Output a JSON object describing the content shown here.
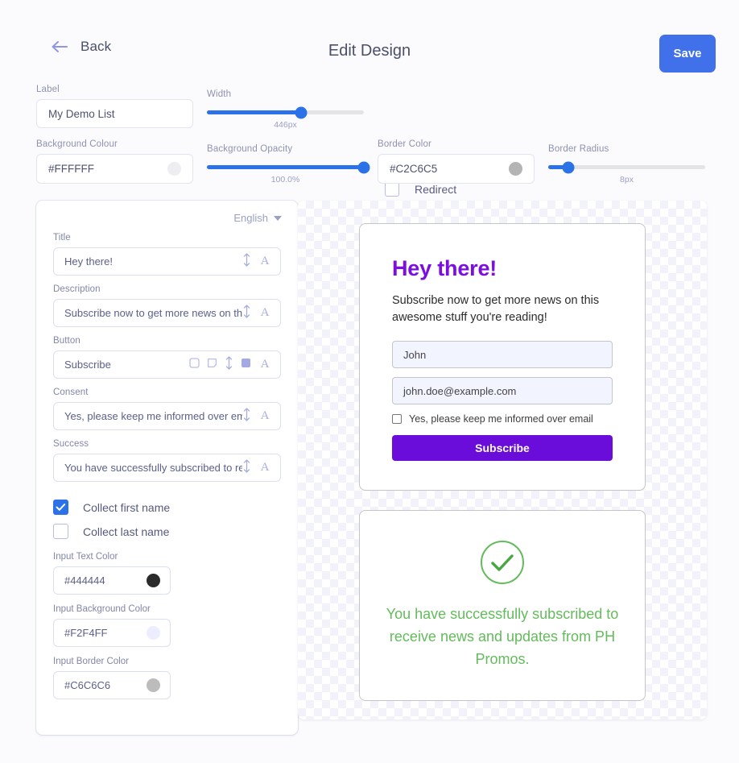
{
  "header": {
    "back_label": "Back",
    "title": "Edit Design",
    "save_label": "Save"
  },
  "controls": {
    "label_field": {
      "label": "Label",
      "value": "My Demo List"
    },
    "width_slider": {
      "label": "Width",
      "value": "446px",
      "percent": 60
    },
    "redirect": {
      "label": "Redirect",
      "checked": false
    },
    "background_colour": {
      "label": "Background Colour",
      "value": "#FFFFFF",
      "swatch": "#eeeef2"
    },
    "background_opacity": {
      "label": "Background Opacity",
      "value": "100.0%",
      "percent": 100
    },
    "border_color": {
      "label": "Border Color",
      "value": "#C2C6C5",
      "swatch": "#b4b4b4"
    },
    "border_radius": {
      "label": "Border Radius",
      "value": "8px",
      "percent": 13
    }
  },
  "editor": {
    "language": "English",
    "fields": [
      {
        "label": "Title",
        "value": "Hey there!"
      },
      {
        "label": "Description",
        "value": "Subscribe now to get more news on this awes"
      },
      {
        "label": "Button",
        "value": "Subscribe"
      },
      {
        "label": "Consent",
        "value": "Yes, please keep me informed over email"
      },
      {
        "label": "Success",
        "value": "You have successfully subscribed to receive r"
      }
    ],
    "collect_first_name": {
      "label": "Collect first name",
      "checked": true
    },
    "collect_last_name": {
      "label": "Collect last name",
      "checked": false
    },
    "input_text_color": {
      "label": "Input Text Color",
      "value": "#444444",
      "swatch": "#2b2b2b"
    },
    "input_background_color": {
      "label": "Input Background Color",
      "value": "#F2F4FF",
      "swatch": "#eceeff"
    },
    "input_border_color": {
      "label": "Input Border Color",
      "value": "#C6C6C6",
      "swatch": "#bcbcbc"
    }
  },
  "preview": {
    "title": "Hey there!",
    "description": "Subscribe now to get more news on this awesome stuff you're reading!",
    "first_name_placeholder": "John",
    "email_placeholder": "john.doe@example.com",
    "consent_label": "Yes, please keep me informed over email",
    "button_label": "Subscribe",
    "success_message": "You have successfully subscribed to receive news and updates from PH Promos."
  },
  "colors": {
    "accent_blue": "#2b72e8",
    "save_blue": "#4070ea",
    "preview_purple": "#7b0ee0",
    "button_purple": "#6a0ddb",
    "success_green": "#63bb5c"
  }
}
